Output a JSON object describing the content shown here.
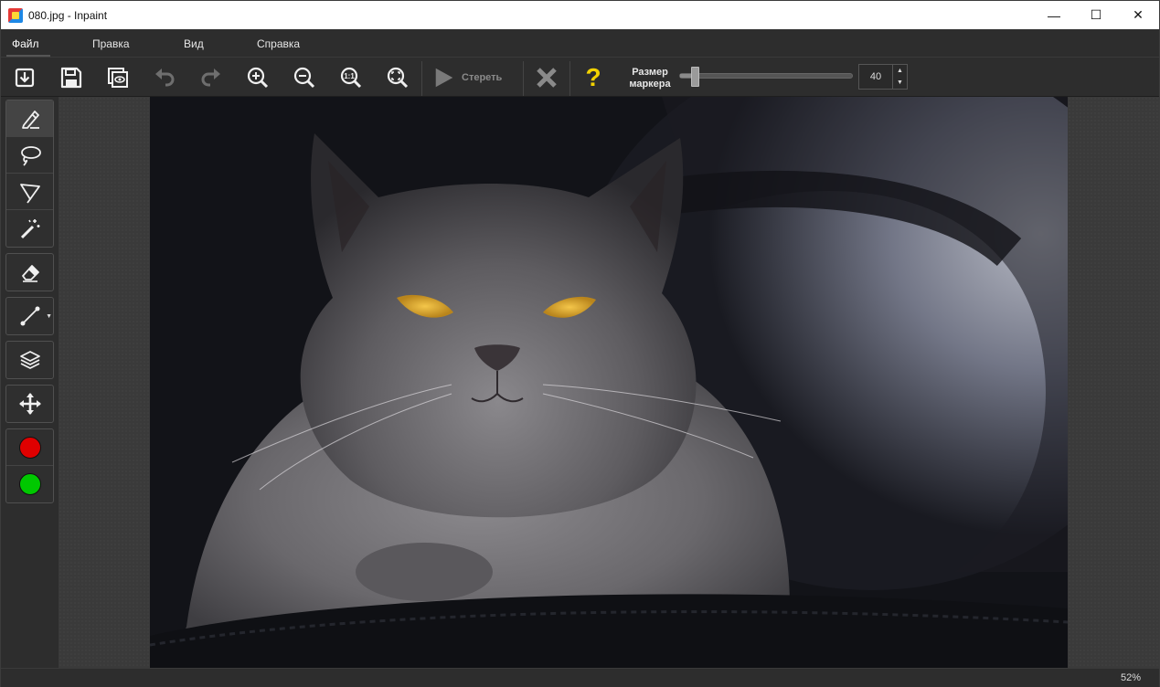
{
  "window": {
    "title": "080.jpg - Inpaint"
  },
  "window_controls": {
    "minimize": "—",
    "maximize": "☐",
    "close": "✕"
  },
  "menu": {
    "items": [
      "Файл",
      "Правка",
      "Вид",
      "Справка"
    ],
    "active": "Файл"
  },
  "toolbar": {
    "buttons": [
      "open-icon",
      "save-icon",
      "preview-icon",
      "undo-icon",
      "redo-icon",
      "zoom-in-icon",
      "zoom-out-icon",
      "zoom-1-1-icon",
      "zoom-fit-icon"
    ],
    "zoom_1_1_label": "1:1",
    "erase_label": "Стереть",
    "help_label": "?",
    "marker_size_label_line1": "Размер",
    "marker_size_label_line2": "маркера",
    "marker_size_value": "40",
    "marker_slider_fraction": 0.05
  },
  "tools": {
    "selection": [
      "marker-icon",
      "lasso-icon",
      "polygon-lasso-icon",
      "magic-wand-icon"
    ],
    "eraser": "eraser-icon",
    "line": "line-tool-icon",
    "layers": "layers-icon",
    "move": "move-icon",
    "colors": {
      "red": "#e00000",
      "green": "#00c800"
    }
  },
  "colors": {
    "accent_help": "#f2d200",
    "background": "#2d2d2d"
  },
  "status": {
    "zoom": "52%"
  }
}
